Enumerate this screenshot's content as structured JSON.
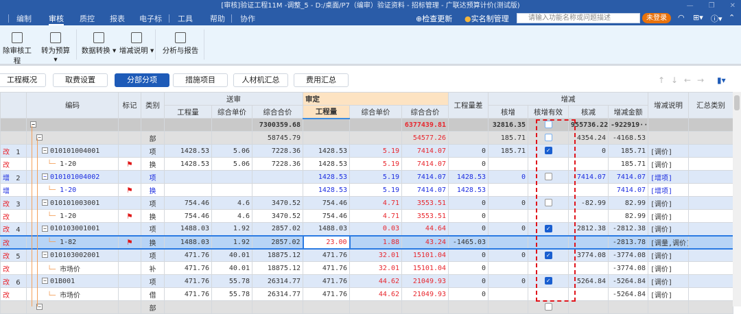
{
  "title": "[审核]验证工程11M -调整_5 - D:/桌面/P7（编审）验证资料 - 招标管理 - 广联达预算计价(测试版)",
  "menu": [
    "编制",
    "审核",
    "质控",
    "报表",
    "电子标",
    "工具",
    "帮助",
    "协作"
  ],
  "menu_active": 1,
  "topright": {
    "update": "检查更新",
    "realname": "实名制管理",
    "search_placeholder": "请输入功能名称或问题描述",
    "login": "未登录"
  },
  "ribbon": [
    {
      "label": "除审核工程",
      "icon": "trash-icon"
    },
    {
      "label": "转为预算 ▾",
      "icon": "convert-budget-icon"
    },
    {
      "label": "数据转换 ▾",
      "icon": "data-convert-icon"
    },
    {
      "label": "增减说明 ▾",
      "icon": "change-note-icon"
    },
    {
      "label": "分析与报告",
      "icon": "report-icon"
    }
  ],
  "tabs": [
    "工程概况",
    "取费设置",
    "分部分项",
    "措施项目",
    "人材机汇总",
    "费用汇总"
  ],
  "tab_active": 2,
  "headers": {
    "code": "编码",
    "mark": "标记",
    "type": "类别",
    "submitted": "送审",
    "approved": "审定",
    "qty": "工程量",
    "unit_price": "综合单价",
    "total": "综合合价",
    "qty_diff": "工程量差",
    "change": "增减",
    "inc": "核增",
    "inc_valid": "核增有效",
    "dec": "核减",
    "amount": "增减金额",
    "note": "增减说明",
    "summary": "汇总类别"
  },
  "rows": [
    {
      "kind": "total",
      "tag": "",
      "num": "",
      "code": "",
      "lvl": 0,
      "flag": false,
      "type": "",
      "c": [
        "",
        "",
        "7300359.68",
        "",
        "",
        "6377439.81",
        "",
        "32816.35",
        null,
        "955736.22",
        "-922919···",
        ""
      ],
      "cb": "light",
      "color": ""
    },
    {
      "kind": "part",
      "tag": "",
      "num": "",
      "code": "",
      "lvl": 1,
      "flag": false,
      "type": "部",
      "c": [
        "",
        "",
        "58745.79",
        "",
        "",
        "54577.26",
        "",
        "185.71",
        null,
        "4354.24",
        "-4168.53",
        ""
      ],
      "cb": "light",
      "color": ""
    },
    {
      "kind": "item",
      "tag": "改",
      "num": "1",
      "code": "010101004001",
      "lvl": 2,
      "flag": false,
      "type": "项",
      "c": [
        "1428.53",
        "5.06",
        "7228.36",
        "1428.53",
        "5.19",
        "7414.07",
        "0",
        "185.71",
        null,
        "0",
        "185.71",
        "[调价]"
      ],
      "cb": "on",
      "color": ""
    },
    {
      "kind": "sub",
      "tag": "改",
      "num": "",
      "code": "1-20",
      "lvl": 3,
      "flag": true,
      "type": "换",
      "c": [
        "1428.53",
        "5.06",
        "7228.36",
        "1428.53",
        "5.19",
        "7414.07",
        "0",
        "",
        null,
        "",
        "185.71",
        "[调价]"
      ],
      "cb": "",
      "color": ""
    },
    {
      "kind": "item",
      "tag": "增",
      "num": "2",
      "code": "010101004002",
      "lvl": 2,
      "flag": false,
      "type": "项",
      "c": [
        "",
        "",
        "",
        "1428.53",
        "5.19",
        "7414.07",
        "1428.53",
        "0",
        null,
        "-7414.07",
        "7414.07",
        "[增项]"
      ],
      "cb": "off",
      "color": "blue"
    },
    {
      "kind": "sub",
      "tag": "增",
      "num": "",
      "code": "1-20",
      "lvl": 3,
      "flag": true,
      "type": "换",
      "c": [
        "",
        "",
        "",
        "1428.53",
        "5.19",
        "7414.07",
        "1428.53",
        "",
        null,
        "",
        "7414.07",
        "[增项]"
      ],
      "cb": "",
      "color": "blue"
    },
    {
      "kind": "item",
      "tag": "改",
      "num": "3",
      "code": "010101003001",
      "lvl": 2,
      "flag": false,
      "type": "项",
      "c": [
        "754.46",
        "4.6",
        "3470.52",
        "754.46",
        "4.71",
        "3553.51",
        "0",
        "0",
        null,
        "-82.99",
        "82.99",
        "[调价]"
      ],
      "cb": "off",
      "color": ""
    },
    {
      "kind": "sub",
      "tag": "改",
      "num": "",
      "code": "1-20",
      "lvl": 3,
      "flag": true,
      "type": "换",
      "c": [
        "754.46",
        "4.6",
        "3470.52",
        "754.46",
        "4.71",
        "3553.51",
        "0",
        "",
        null,
        "",
        "82.99",
        "[调价]"
      ],
      "cb": "",
      "color": ""
    },
    {
      "kind": "item",
      "tag": "改",
      "num": "4",
      "code": "010103001001",
      "lvl": 2,
      "flag": false,
      "type": "项",
      "c": [
        "1488.03",
        "1.92",
        "2857.02",
        "1488.03",
        "0.03",
        "44.64",
        "0",
        "0",
        null,
        "2812.38",
        "-2812.38",
        "[调价]"
      ],
      "cb": "on",
      "color": ""
    },
    {
      "kind": "sel",
      "tag": "改",
      "num": "",
      "code": "1-82",
      "lvl": 3,
      "flag": true,
      "type": "换",
      "c": [
        "1488.03",
        "1.92",
        "2857.02",
        "23.00",
        "1.88",
        "43.24",
        "-1465.03",
        "",
        null,
        "",
        "-2813.78",
        "[调量,调价]"
      ],
      "cb": "",
      "color": ""
    },
    {
      "kind": "item",
      "tag": "改",
      "num": "5",
      "code": "010103002001",
      "lvl": 2,
      "flag": false,
      "type": "项",
      "c": [
        "471.76",
        "40.01",
        "18875.12",
        "471.76",
        "32.01",
        "15101.04",
        "0",
        "0",
        null,
        "3774.08",
        "-3774.08",
        "[调价]"
      ],
      "cb": "on",
      "color": ""
    },
    {
      "kind": "sub",
      "tag": "改",
      "num": "",
      "code": "市场价",
      "lvl": 3,
      "flag": false,
      "type": "补",
      "c": [
        "471.76",
        "40.01",
        "18875.12",
        "471.76",
        "32.01",
        "15101.04",
        "0",
        "",
        null,
        "",
        "-3774.08",
        "[调价]"
      ],
      "cb": "",
      "color": ""
    },
    {
      "kind": "item",
      "tag": "改",
      "num": "6",
      "code": "01B001",
      "lvl": 2,
      "flag": false,
      "type": "项",
      "c": [
        "471.76",
        "55.78",
        "26314.77",
        "471.76",
        "44.62",
        "21049.93",
        "0",
        "0",
        null,
        "5264.84",
        "-5264.84",
        "[调价]"
      ],
      "cb": "on",
      "color": ""
    },
    {
      "kind": "sub",
      "tag": "改",
      "num": "",
      "code": "市场价",
      "lvl": 3,
      "flag": false,
      "type": "借",
      "c": [
        "471.76",
        "55.78",
        "26314.77",
        "471.76",
        "44.62",
        "21049.93",
        "0",
        "",
        null,
        "",
        "-5264.84",
        "[调价]"
      ],
      "cb": "",
      "color": ""
    },
    {
      "kind": "part",
      "tag": "",
      "num": "",
      "code": "",
      "lvl": 1,
      "flag": false,
      "type": "部",
      "c": [
        "",
        "",
        "",
        "",
        "",
        "",
        "",
        "",
        "",
        null,
        "",
        "",
        ""
      ],
      "cb": "off",
      "color": ""
    }
  ],
  "colors": {
    "accent": "#1e5bb8",
    "titlebar": "#2a5ca8",
    "red": "#e8262d",
    "blue": "#1c2de0",
    "login": "#e8720c"
  }
}
